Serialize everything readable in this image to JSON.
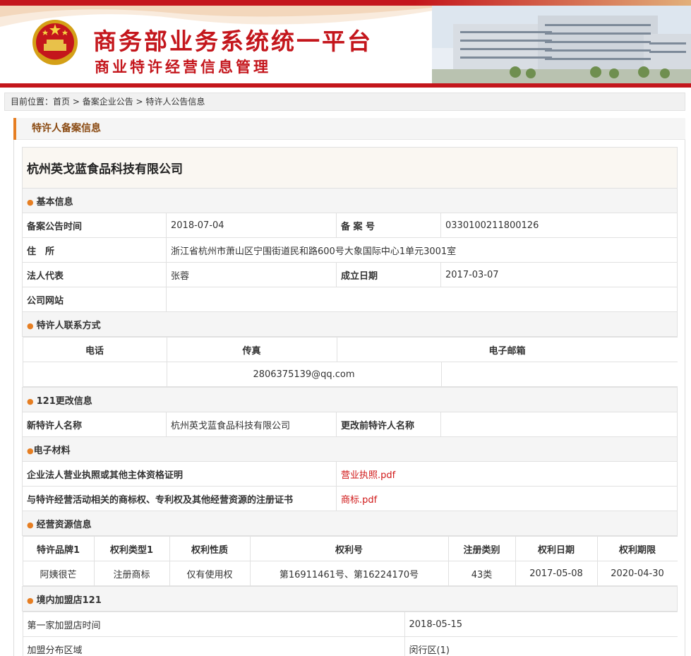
{
  "header": {
    "title": "商务部业务系统统一平台",
    "subtitle": "商业特许经营信息管理"
  },
  "breadcrumb": {
    "prefix": "目前位置：",
    "items": [
      "首页",
      "备案企业公告",
      "特许人公告信息"
    ],
    "separator": " > "
  },
  "section": {
    "title": "特许人备案信息"
  },
  "company": {
    "name": "杭州英戈蓝食品科技有限公司"
  },
  "basic": {
    "heading": "基本信息",
    "announce_date_label": "备案公告时间",
    "announce_date": "2018-07-04",
    "record_no_label": "备 案 号",
    "record_no": "0330100211800126",
    "address_label": "住　所",
    "address": "浙江省杭州市萧山区宁围街道民和路600号大象国际中心1单元3001室",
    "legal_rep_label": "法人代表",
    "legal_rep": "张蓉",
    "founded_label": "成立日期",
    "founded": "2017-03-07",
    "website_label": "公司网站",
    "website": ""
  },
  "contact": {
    "heading": "特许人联系方式",
    "phone_label": "电话",
    "fax_label": "传真",
    "email_label": "电子邮箱",
    "phone": "",
    "fax": "",
    "email": "2806375139@qq.com"
  },
  "change": {
    "heading": "121更改信息",
    "new_name_label": "新特许人名称",
    "new_name": "杭州英戈蓝食品科技有限公司",
    "old_name_label": "更改前特许人名称",
    "old_name": ""
  },
  "materials": {
    "heading": "电子材料",
    "items": [
      {
        "label": "企业法人营业执照或其他主体资格证明",
        "file": "营业执照.pdf"
      },
      {
        "label": "与特许经营活动相关的商标权、专利权及其他经营资源的注册证书",
        "file": "商标.pdf"
      }
    ]
  },
  "resources": {
    "heading": "经营资源信息",
    "columns": [
      "特许品牌1",
      "权利类型1",
      "权利性质",
      "权利号",
      "注册类别",
      "权利日期",
      "权利期限"
    ],
    "rows": [
      [
        "阿姨很芒",
        "注册商标",
        "仅有使用权",
        "第16911461号、第16224170号",
        "43类",
        "2017-05-08",
        "2020-04-30"
      ]
    ]
  },
  "stores": {
    "heading": "境内加盟店121",
    "first_store_label": "第一家加盟店时间",
    "first_store": "2018-05-15",
    "area_label": "加盟分布区域",
    "area": "闵行区(1)"
  },
  "colors": {
    "brand_red": "#c4161c",
    "accent_orange": "#e67e22",
    "link_red": "#d01818"
  }
}
